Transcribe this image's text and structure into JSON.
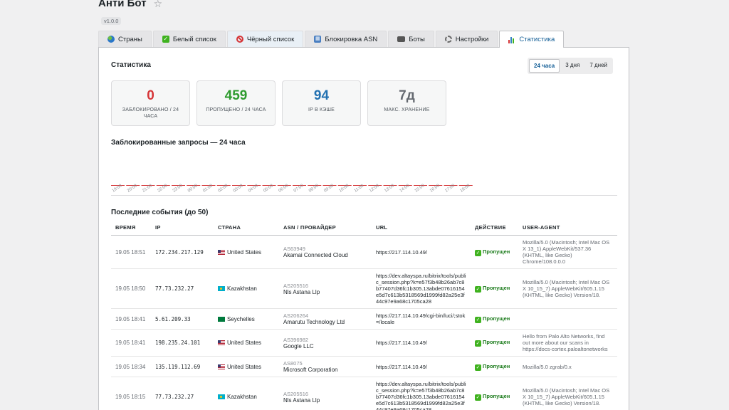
{
  "header": {
    "title": "Анти Бот",
    "version": "v1.0.0"
  },
  "tabs": [
    {
      "label": "Страны",
      "icon": "globe-icon"
    },
    {
      "label": "Белый список",
      "icon": "check-icon"
    },
    {
      "label": "Чёрный список",
      "icon": "no-entry-icon"
    },
    {
      "label": "Блокировка ASN",
      "icon": "grid-icon"
    },
    {
      "label": "Боты",
      "icon": "robot-icon"
    },
    {
      "label": "Настройки",
      "icon": "gear-icon"
    },
    {
      "label": "Статистика",
      "icon": "chart-icon"
    }
  ],
  "stats": {
    "title": "Статистика",
    "periods": [
      "24 часа",
      "3 дня",
      "7 дней"
    ],
    "cards": [
      {
        "value": "0",
        "label": "Заблокировано / 24 часа",
        "color": "#d63638"
      },
      {
        "value": "459",
        "label": "Пропущено / 24 часа",
        "color": "#2e9b2e"
      },
      {
        "value": "94",
        "label": "IP в кэше",
        "color": "#2271b1"
      },
      {
        "value": "7д",
        "label": "Макс. хранение",
        "color": "#646970"
      }
    ]
  },
  "blocked_chart": {
    "title": "Заблокированные запросы — 24 часа",
    "bar_color": "#d63638"
  },
  "chart_data": {
    "type": "bar",
    "title": "Заблокированные запросы — 24 часа",
    "categories": [
      "19:00",
      "20:00",
      "21:00",
      "22:00",
      "23:00",
      "00:00",
      "01:00",
      "02:00",
      "03:00",
      "04:00",
      "05:00",
      "06:00",
      "07:00",
      "08:00",
      "09:00",
      "10:00",
      "11:00",
      "12:00",
      "13:00",
      "14:00",
      "15:00",
      "16:00",
      "17:00",
      "18:00"
    ],
    "values": [
      0,
      0,
      0,
      0,
      0,
      0,
      0,
      0,
      0,
      0,
      0,
      0,
      0,
      0,
      0,
      0,
      0,
      0,
      0,
      0,
      0,
      0,
      0,
      0
    ]
  },
  "events": {
    "title": "Последние события (до 50)",
    "columns": [
      "Время",
      "IP",
      "Страна",
      "ASN / Провайдер",
      "URL",
      "Действие",
      "User-Agent"
    ],
    "rows": [
      {
        "time": "19.05 18:51",
        "ip": "172.234.217.129",
        "country": "United States",
        "flag": "us",
        "asn": "AS63949",
        "provider": "Akamai Connected Cloud",
        "url": "https://217.114.10.49/",
        "action": "Пропущен",
        "ua": "Mozilla/5.0 (Macintosh; Intel Mac OS X 13_1) AppleWebKit/537.36 (KHTML, like Gecko) Chrome/108.0.0.0"
      },
      {
        "time": "19.05 18:50",
        "ip": "77.73.232.27",
        "country": "Kazakhstan",
        "flag": "kz",
        "asn": "AS205516",
        "provider": "Nls Astana Llp",
        "url": "https://dev.altayspa.ru/bitrix/tools/public_session.php?k=e57f3b48b26ab7c8b77407d36fc1b305.13abde07616154e5d7c613b5318569d1999fd82a25e3f44c97e9a68c1705ca28",
        "action": "Пропущен",
        "ua": "Mozilla/5.0 (Macintosh; Intel Mac OS X 10_15_7) AppleWebKit/605.1.15 (KHTML, like Gecko) Version/18."
      },
      {
        "time": "19.05 18:41",
        "ip": "5.61.209.33",
        "country": "Seychelles",
        "flag": "sc",
        "asn": "AS206264",
        "provider": "Amarutu Technology Ltd",
        "url": "https://217.114.10.49/cgi-bin/luci/;stok=/locale",
        "action": "Пропущен",
        "ua": ""
      },
      {
        "time": "19.05 18:41",
        "ip": "198.235.24.101",
        "country": "United States",
        "flag": "us",
        "asn": "AS396982",
        "provider": "Google LLC",
        "url": "https://217.114.10.49/",
        "action": "Пропущен",
        "ua": "Hello from Palo Alto Networks, find out more about our scans in https://docs-cortex.paloaltonetworks"
      },
      {
        "time": "19.05 18:34",
        "ip": "135.119.112.69",
        "country": "United States",
        "flag": "us",
        "asn": "AS8075",
        "provider": "Microsoft Corporation",
        "url": "https://217.114.10.49/",
        "action": "Пропущен",
        "ua": "Mozilla/5.0 zgrab/0.x"
      },
      {
        "time": "19.05 18:15",
        "ip": "77.73.232.27",
        "country": "Kazakhstan",
        "flag": "kz",
        "asn": "AS205516",
        "provider": "Nls Astana Llp",
        "url": "https://dev.altayspa.ru/bitrix/tools/public_session.php?k=e57f3b48b26ab7c8b77407d36fc1b305.13abde07616154e5d7c613b5318569d1999fd82a25e3f44c97e9a68c1705ca28",
        "action": "Пропущен",
        "ua": "Mozilla/5.0 (Macintosh; Intel Mac OS X 10_15_7) AppleWebKit/605.1.15 (KHTML, like Gecko) Version/18."
      }
    ]
  }
}
